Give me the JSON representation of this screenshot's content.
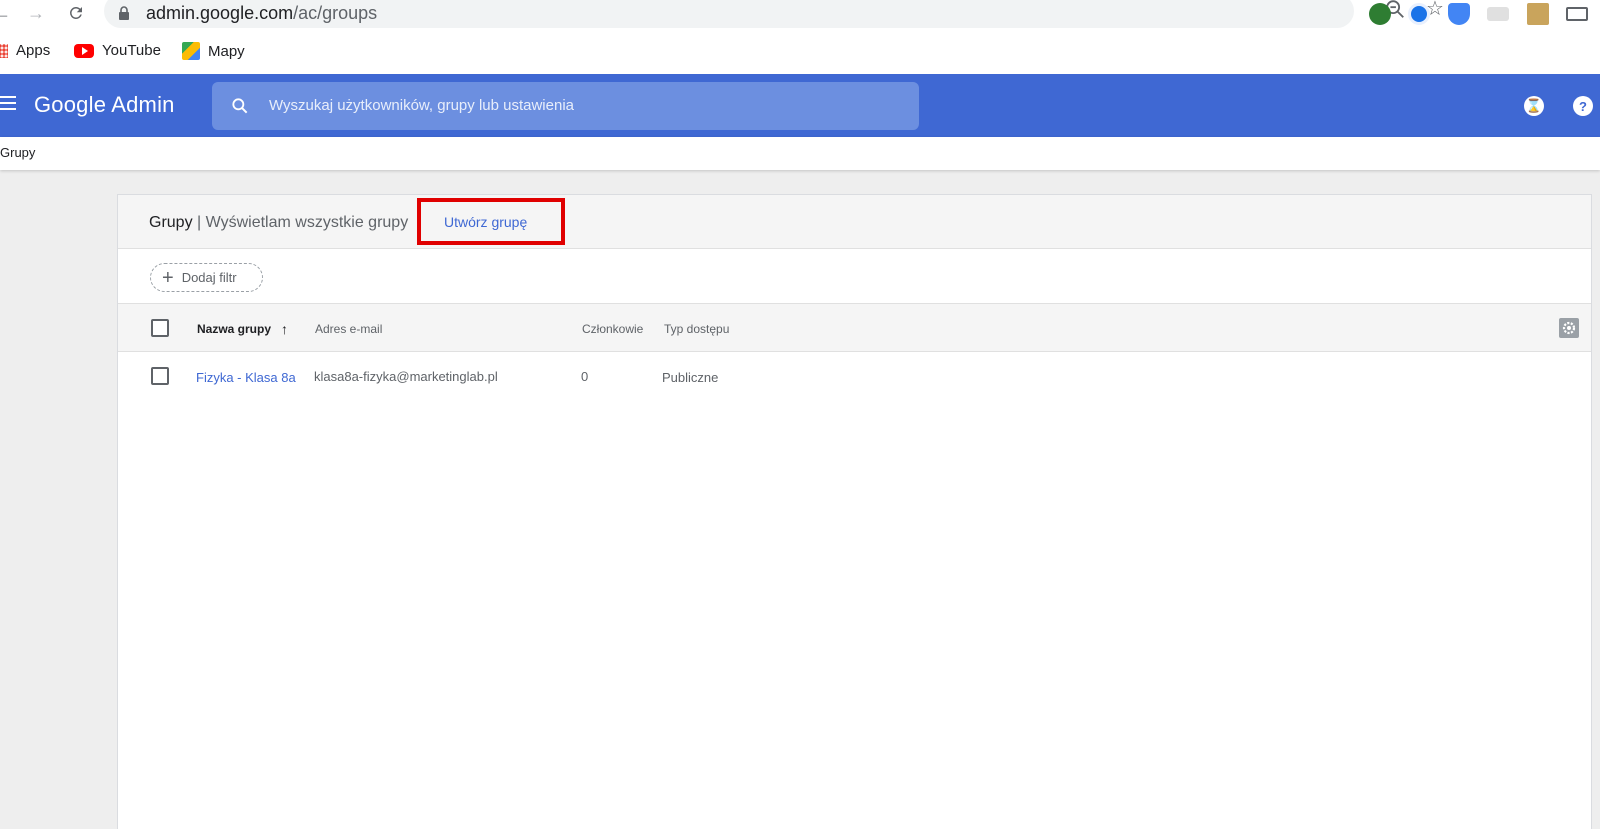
{
  "browser": {
    "url_host": "admin.google.com",
    "url_path": "/ac/groups",
    "icons": {
      "back": "arrow-left-icon",
      "forward": "arrow-right-icon",
      "reload": "reload-icon",
      "lock": "lock-icon",
      "zoom": "zoom-out-icon",
      "star": "star-icon"
    }
  },
  "bookmarks": [
    {
      "label": "Apps"
    },
    {
      "label": "YouTube"
    },
    {
      "label": "Mapy"
    }
  ],
  "header": {
    "logo": "Google Admin",
    "search_placeholder": "Wyszukaj użytkowników, grupy lub ustawienia",
    "accent_color": "#3f68d3"
  },
  "breadcrumb": "Grupy",
  "card": {
    "title": "Grupy",
    "subtitle": "| Wyświetlam wszystkie grupy",
    "create_button": "Utwórz grupę",
    "highlight_color": "#e00000",
    "add_filter": "Dodaj filtr"
  },
  "table": {
    "columns": [
      "Nazwa grupy",
      "Adres e-mail",
      "Członkowie",
      "Typ dostępu"
    ],
    "rows": [
      {
        "name": "Fizyka - Klasa 8a",
        "email": "klasa8a-fizyka@marketinglab.pl",
        "members": "0",
        "access": "Publiczne"
      }
    ]
  }
}
